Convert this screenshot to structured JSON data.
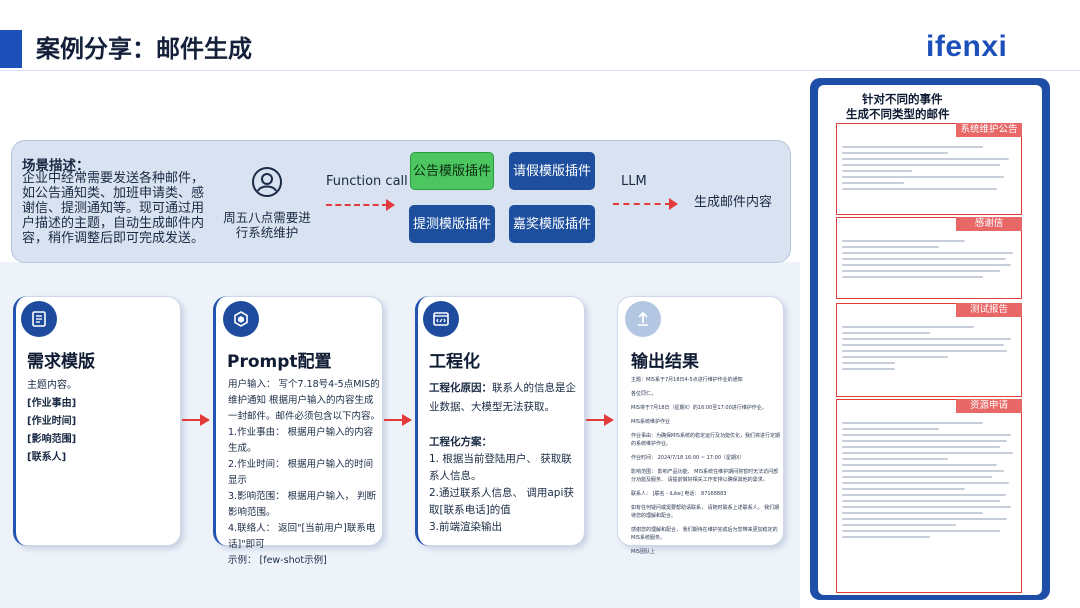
{
  "header": {
    "title": "案例分享：邮件生成",
    "logo": "ifenxi"
  },
  "scenario": {
    "title": "场景描述：",
    "text": "企业中经常需要发送各种邮件，如公告通知类、加班申请类、感谢信、提测通知等。现可通过用户描述的主题，自动生成邮件内容，稍作调整后即可完成发送。",
    "user_text": "周五八点需要进行系统维护",
    "function_call": "Function call",
    "plugins": [
      "公告模版插件",
      "请假模版插件",
      "提测模版插件",
      "嘉奖模版插件"
    ],
    "llm": "LLM",
    "output": "生成邮件内容"
  },
  "cards": {
    "template": {
      "title": "需求模版",
      "lines": [
        "主题内容。",
        "[作业事由]",
        "[作业时间]",
        "[影响范围]",
        "[联系人]"
      ]
    },
    "prompt": {
      "title": "Prompt配置",
      "lines": [
        "用户输入：  写个7.18号4-5点MIS的",
        "维护通知 根据用户输入的内容生成",
        "一封邮件。邮件必须包含以下内容。",
        "1.作业事由：  根据用户输入的内容",
        "生成。",
        "2.作业时间：  根据用户输入的时间",
        "显示",
        "3.影响范围：  根据用户输入，  判断",
        "影响范围。",
        "4.联络人：  返回\"[当前用户]联系电",
        "话]\"即可",
        "示例：   [few-shot示例]"
      ]
    },
    "engineering": {
      "title": "工程化",
      "reason_label": "工程化原因：",
      "reason_text": "联系人的信息是企业数据、大模型无法获取。",
      "plan_label": "工程化方案：",
      "plan_lines": [
        "1. 根据当前登陆用户、  获取联系人信息。",
        "2.通过联系人信息、  调用api获取[联系电话]的值",
        "3.前端渲染输出"
      ]
    },
    "output": {
      "title": "输出结果",
      "lines": [
        "主题：MIS系于7月18日4-5点进行维护作业的通知",
        "各位同仁，",
        "MIS将于7月18日（星期X）的16:00至17:00进行维护作业。",
        "MIS系统维护作业",
        "作业事由：为确保MIS系统的稳定运行及功能优化，我们将进行定期的系统维护作业。",
        "作业时间：   2024/7/18 16:00 ~ 17:00（星期X）",
        "影响范围：  影响产品功能、   MIS系统在维护期间将暂时无法访问部分功能及服务、  请提前做好相关工作安排以确保其他的需求。",
        "联系人：  [联名 - iLike] 电话：  87168883",
        "如有任何疑问或需要帮助请联系，  请随时联系上述联系人。  我们期待您的理解和配合。",
        "感谢您的理解和配合，  我们期待在维护完成后为您带来更加稳定的MIS系统服务。",
        "MIS团队上"
      ]
    }
  },
  "right_panel": {
    "title_line1": "针对不同的事件",
    "title_line2": "生成不同类型的邮件",
    "tags": [
      "系统维护公告",
      "感谢信",
      "测试报告",
      "资源申请"
    ]
  },
  "colors": {
    "brand": "#1d4fb8",
    "accent_red": "#e23b3b",
    "green": "#4cc760"
  }
}
